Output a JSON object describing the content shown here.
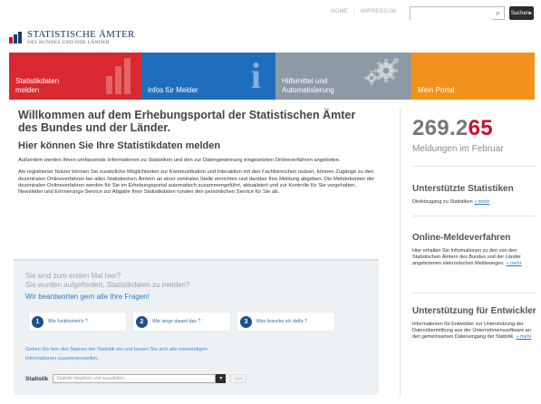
{
  "header": {
    "utility_links": [
      "HOME",
      "IMPRESSUM"
    ],
    "search": {
      "placeholder": "",
      "button": "Suchen"
    },
    "logo": {
      "title": "STATISTISCHE ÄMTER",
      "subtitle": "DES BUNDES UND DER LÄNDER"
    }
  },
  "tiles": [
    {
      "label": "Statistikdaten\nmelden",
      "color": "#d9282f",
      "icon": "bar-chart-icon"
    },
    {
      "label": "Infos für Melder",
      "color": "#1f6ebd",
      "icon": "info-icon"
    },
    {
      "label": "Hilfsmittel und\nAutomatisierung",
      "color": "#8d9aa6",
      "icon": "gears-icon"
    },
    {
      "label": "Mein Portal",
      "color": "#f2921c",
      "icon": ""
    }
  ],
  "main": {
    "welcome": "Willkommen auf dem Erhebungsportal der Statistischen Ämter des Bundes und der Länder.",
    "subheading": "Hier können Sie Ihre Statistikdaten melden",
    "para1": "Außerdem werden Ihnen umfassende Informationen zu Statistiken und den zur Datengewinnung eingesetzten Onlineverfahren angeboten.",
    "para2": "Als registrierter Nutzer können Sie zusätzliche Möglichkeiten zur Kommunikation und Interaktion mit den Fachbereichen nutzen, können Zugänge zu den dezentralen Onlineverfahren bei allen Statistischen Ämtern an einer zentralen Stelle einrichten und darüber Ihre Meldung abgeben. Die Melderkonten der dezentralen Onlineverfahren werden für Sie im Erhebungsportal automatisch zusammengeführt, aktualisiert und zur Kontrolle für Sie vorgehalten. Newsletter und Erinnerungs-Service zur Abgabe Ihrer Statistikdaten runden den persönlichen Service für Sie ab."
  },
  "faq": {
    "q1": "Sie sind zum ersten Mal hier?",
    "q2": "Sie wurden aufgefordert, Statistikdaten zu melden?",
    "cta": "Wir beantworten gern alle Ihre Fragen!",
    "steps": [
      {
        "num": "1",
        "text": "Wie funktioniert's ?"
      },
      {
        "num": "2",
        "text": "Wie lange dauert das ?"
      },
      {
        "num": "3",
        "text": "Was brauche ich dafür ?"
      }
    ],
    "hint": "Geben Sie hier den Namen der Statistik ein und lassen Sie sich alle notwendigen Informationen zusammenstellen.",
    "statistik_label": "Statistik",
    "statistik_placeholder": "Statistik eingeben und auswählen",
    "go_button": "Los"
  },
  "sidebar": {
    "counter_prefix": "269.2",
    "counter_highlight": "65",
    "counter_caption": "Meldungen im Februar",
    "blocks": [
      {
        "title": "Unterstützte Statistiken",
        "text": "Direktzugang zu Statistiken",
        "link": "» mehr"
      },
      {
        "title": "Online-Meldeverfahren",
        "text": "Hier erhalten Sie Informationen zu den von den Statistischen Ämtern des Bundes und der Länder angebotenen elekronischen Meldewegen.",
        "link": "» mehr"
      },
      {
        "title": "Unterstützung für Entwickler",
        "text": "Informationen für Entwickler zur Unterstützung der Datenübermittlung aus der Unternehmenssoftware an den gemeinsamen Dateneingang der Statistik.",
        "link": "» mehr"
      }
    ]
  }
}
